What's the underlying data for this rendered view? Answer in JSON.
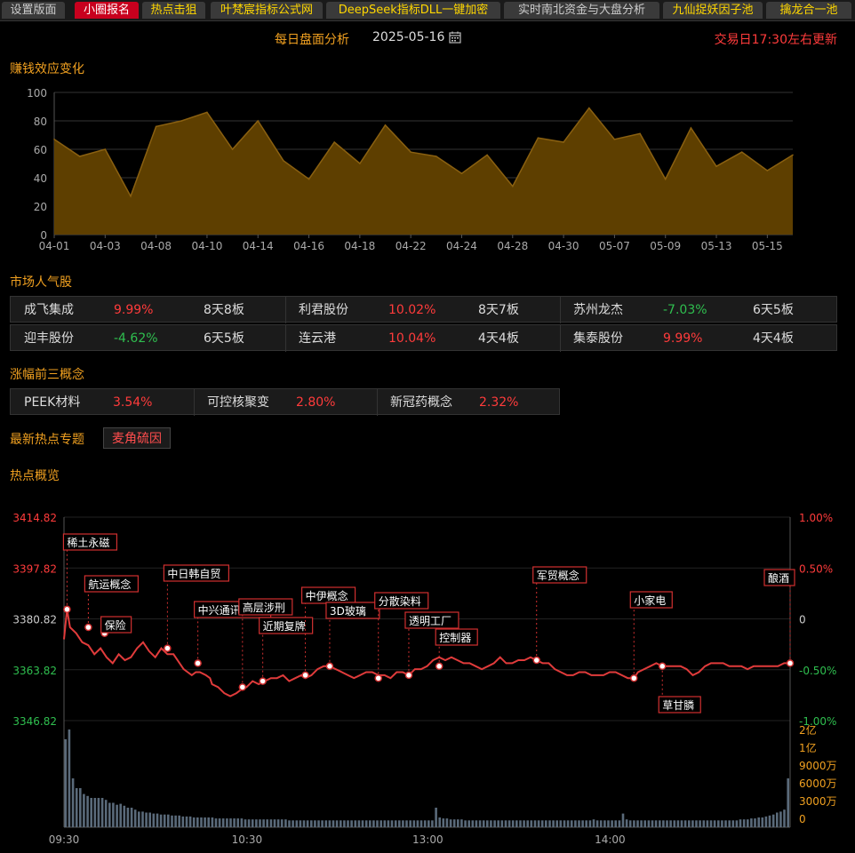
{
  "tabs": [
    {
      "label": "设置版面",
      "style": "normal"
    },
    {
      "label": "小圈报名",
      "style": "active"
    },
    {
      "label": "热点击狙",
      "style": "yellow"
    },
    {
      "label": "叶梵宸指标公式网",
      "style": "yellow"
    },
    {
      "label": "DeepSeek指标DLL一键加密",
      "style": "yellow"
    },
    {
      "label": "实时南北资金与大盘分析",
      "style": "normal"
    },
    {
      "label": "九仙捉妖因子池",
      "style": "yellow"
    },
    {
      "label": "擒龙合一池",
      "style": "yellow"
    }
  ],
  "header": {
    "title": "每日盘面分析",
    "date": "2025-05-16",
    "update_note": "交易日17:30左右更新"
  },
  "sections": {
    "money_effect": "赚钱效应变化",
    "popular": "市场人气股",
    "top3": "涨幅前三概念",
    "hot_topic": "最新热点专题",
    "overview": "热点概览"
  },
  "hot_topic_tag": "麦角硫因",
  "popular_stocks": [
    [
      {
        "name": "成飞集成",
        "pct": "9.99%",
        "dir": "up",
        "board": "8天8板"
      },
      {
        "name": "利君股份",
        "pct": "10.02%",
        "dir": "up",
        "board": "8天7板"
      },
      {
        "name": "苏州龙杰",
        "pct": "-7.03%",
        "dir": "down",
        "board": "6天5板"
      }
    ],
    [
      {
        "name": "迎丰股份",
        "pct": "-4.62%",
        "dir": "down",
        "board": "6天5板"
      },
      {
        "name": "连云港",
        "pct": "10.04%",
        "dir": "up",
        "board": "4天4板"
      },
      {
        "name": "集泰股份",
        "pct": "9.99%",
        "dir": "up",
        "board": "4天4板"
      }
    ]
  ],
  "top_concepts": [
    {
      "name": "PEEK材料",
      "pct": "3.54%"
    },
    {
      "name": "可控核聚变",
      "pct": "2.80%"
    },
    {
      "name": "新冠药概念",
      "pct": "2.32%"
    }
  ],
  "colors": {
    "up": "#ff3b3b",
    "down": "#2fbf4f",
    "accent": "#f0a020",
    "area_fill": "#5e3f00",
    "area_line": "#8a6010",
    "intraday": "#e03b3b",
    "volume": "#5a6a7a"
  },
  "chart_data": [
    {
      "type": "area",
      "title": "赚钱效应变化",
      "x": [
        "04-01",
        "04-02",
        "04-03",
        "04-07",
        "04-08",
        "04-09",
        "04-10",
        "04-11",
        "04-14",
        "04-15",
        "04-16",
        "04-17",
        "04-18",
        "04-21",
        "04-22",
        "04-23",
        "04-24",
        "04-25",
        "04-28",
        "04-29",
        "04-30",
        "05-06",
        "05-07",
        "05-08",
        "05-09",
        "05-12",
        "05-13",
        "05-14",
        "05-15",
        "05-16"
      ],
      "x_tick_labels": [
        "04-01",
        "04-03",
        "04-08",
        "04-10",
        "04-14",
        "04-16",
        "04-18",
        "04-22",
        "04-24",
        "04-28",
        "04-30",
        "05-07",
        "05-09",
        "05-13",
        "05-15"
      ],
      "values": [
        67,
        55,
        60,
        27,
        76,
        80,
        86,
        60,
        80,
        52,
        39,
        65,
        50,
        77,
        58,
        55,
        43,
        56,
        34,
        68,
        65,
        89,
        67,
        71,
        39,
        75,
        48,
        58,
        45,
        56
      ],
      "ylim": [
        0,
        100
      ],
      "y_ticks": [
        0,
        20,
        40,
        60,
        80,
        100
      ],
      "grid": true
    },
    {
      "type": "line",
      "title": "热点概览",
      "price_ticks": [
        "3414.82",
        "3397.82",
        "3380.82",
        "3363.82",
        "3346.82"
      ],
      "pct_ticks": [
        "1.00%",
        "0.50%",
        "0",
        "-0.50%",
        "-1.00%"
      ],
      "ylim": [
        3346.82,
        3414.82
      ],
      "x_time_labels": [
        "09:30",
        "10:30",
        "13:00",
        "14:00"
      ],
      "volume_ticks": [
        "2亿",
        "1亿",
        "9000万",
        "6000万",
        "3000万",
        "0"
      ],
      "points": [
        [
          0,
          3374
        ],
        [
          3,
          3384
        ],
        [
          6,
          3378
        ],
        [
          12,
          3376
        ],
        [
          18,
          3373
        ],
        [
          24,
          3372
        ],
        [
          30,
          3369
        ],
        [
          36,
          3371
        ],
        [
          42,
          3368
        ],
        [
          48,
          3366
        ],
        [
          54,
          3369
        ],
        [
          60,
          3367
        ],
        [
          66,
          3368
        ],
        [
          72,
          3371
        ],
        [
          78,
          3373
        ],
        [
          84,
          3370
        ],
        [
          90,
          3368
        ],
        [
          96,
          3371
        ],
        [
          102,
          3369
        ],
        [
          108,
          3369
        ],
        [
          114,
          3366
        ],
        [
          118,
          3364
        ],
        [
          122,
          3363
        ],
        [
          126,
          3362
        ],
        [
          130,
          3363
        ],
        [
          134,
          3363
        ],
        [
          140,
          3362
        ],
        [
          144,
          3361
        ],
        [
          146,
          3359
        ],
        [
          152,
          3358
        ],
        [
          158,
          3356
        ],
        [
          164,
          3355
        ],
        [
          170,
          3356
        ],
        [
          174,
          3357
        ],
        [
          180,
          3358
        ],
        [
          186,
          3360
        ],
        [
          192,
          3359
        ],
        [
          198,
          3360
        ],
        [
          204,
          3361
        ],
        [
          210,
          3361
        ],
        [
          216,
          3362
        ],
        [
          222,
          3360
        ],
        [
          228,
          3361
        ],
        [
          234,
          3362
        ],
        [
          238,
          3361
        ],
        [
          244,
          3362
        ],
        [
          250,
          3364
        ],
        [
          256,
          3365
        ],
        [
          262,
          3365
        ],
        [
          268,
          3364
        ],
        [
          274,
          3363
        ],
        [
          280,
          3362
        ],
        [
          286,
          3361
        ],
        [
          292,
          3362
        ],
        [
          298,
          3363
        ],
        [
          304,
          3363
        ],
        [
          310,
          3362
        ],
        [
          316,
          3362
        ],
        [
          322,
          3361
        ],
        [
          328,
          3363
        ],
        [
          334,
          3363
        ],
        [
          340,
          3362
        ],
        [
          346,
          3364
        ],
        [
          352,
          3364
        ],
        [
          358,
          3365
        ],
        [
          364,
          3367
        ],
        [
          370,
          3368
        ],
        [
          376,
          3367
        ],
        [
          382,
          3368
        ],
        [
          388,
          3367
        ],
        [
          394,
          3366
        ],
        [
          400,
          3366
        ],
        [
          406,
          3365
        ],
        [
          412,
          3364
        ],
        [
          418,
          3365
        ],
        [
          424,
          3366
        ],
        [
          430,
          3368
        ],
        [
          436,
          3366
        ],
        [
          442,
          3366
        ],
        [
          448,
          3367
        ],
        [
          454,
          3367
        ],
        [
          460,
          3368
        ],
        [
          466,
          3367
        ],
        [
          472,
          3366
        ],
        [
          478,
          3366
        ],
        [
          484,
          3364
        ],
        [
          490,
          3363
        ],
        [
          496,
          3362
        ],
        [
          502,
          3362
        ],
        [
          508,
          3363
        ],
        [
          514,
          3363
        ],
        [
          520,
          3362
        ],
        [
          526,
          3362
        ],
        [
          532,
          3362
        ],
        [
          538,
          3363
        ],
        [
          544,
          3363
        ],
        [
          550,
          3362
        ],
        [
          556,
          3361
        ],
        [
          562,
          3361
        ],
        [
          566,
          3363
        ],
        [
          572,
          3364
        ],
        [
          578,
          3365
        ],
        [
          584,
          3366
        ],
        [
          590,
          3365
        ],
        [
          596,
          3365
        ],
        [
          602,
          3365
        ],
        [
          608,
          3365
        ],
        [
          614,
          3364
        ],
        [
          620,
          3362
        ],
        [
          626,
          3363
        ],
        [
          632,
          3365
        ],
        [
          638,
          3366
        ],
        [
          644,
          3366
        ],
        [
          650,
          3366
        ],
        [
          656,
          3365
        ],
        [
          662,
          3365
        ],
        [
          668,
          3365
        ],
        [
          674,
          3364
        ],
        [
          680,
          3365
        ],
        [
          686,
          3365
        ],
        [
          692,
          3365
        ],
        [
          698,
          3365
        ],
        [
          704,
          3365
        ],
        [
          710,
          3366
        ],
        [
          716,
          3366
        ]
      ],
      "events": [
        {
          "label": "稀土永磁",
          "t": 3,
          "value": 3384
        },
        {
          "label": "航运概念",
          "t": 24,
          "value": 3378
        },
        {
          "label": "保险",
          "t": 40,
          "value": 3376
        },
        {
          "label": "中日韩自贸",
          "t": 102,
          "value": 3371
        },
        {
          "label": "中兴通讯概念",
          "t": 132,
          "value": 3366
        },
        {
          "label": "高层涉刑",
          "t": 176,
          "value": 3358
        },
        {
          "label": "近期复牌",
          "t": 196,
          "value": 3360
        },
        {
          "label": "中伊概念",
          "t": 238,
          "value": 3362
        },
        {
          "label": "3D玻璃",
          "t": 262,
          "value": 3365
        },
        {
          "label": "分散染料",
          "t": 310,
          "value": 3361
        },
        {
          "label": "透明工厂",
          "t": 340,
          "value": 3362
        },
        {
          "label": "控制器",
          "t": 370,
          "value": 3365
        },
        {
          "label": "军贸概念",
          "t": 466,
          "value": 3367
        },
        {
          "label": "小家电",
          "t": 562,
          "value": 3361
        },
        {
          "label": "草甘膦",
          "t": 590,
          "value": 3365
        },
        {
          "label": "酿酒",
          "t": 716,
          "value": 3366
        }
      ],
      "volume": [
        9,
        10,
        5,
        4,
        4,
        3.4,
        3.2,
        3.0,
        3.0,
        3.0,
        3.0,
        2.8,
        2.5,
        2.5,
        2.3,
        2.4,
        2.2,
        2.0,
        2.0,
        1.8,
        1.6,
        1.6,
        1.5,
        1.5,
        1.4,
        1.4,
        1.3,
        1.3,
        1.3,
        1.2,
        1.2,
        1.2,
        1.1,
        1.1,
        1.1,
        1.0,
        1.0,
        1.0,
        1.0,
        1.0,
        1.0,
        0.9,
        0.9,
        0.9,
        0.9,
        0.9,
        0.9,
        0.9,
        0.9,
        0.8,
        0.8,
        0.8,
        0.8,
        0.8,
        0.8,
        0.8,
        0.8,
        0.8,
        0.8,
        0.8,
        0.8,
        0.7,
        0.7,
        0.7,
        0.7,
        0.7,
        0.7,
        0.7,
        0.7,
        0.7,
        0.7,
        0.7,
        0.7,
        0.7,
        0.7,
        0.7,
        0.7,
        0.7,
        0.7,
        0.7,
        0.7,
        0.7,
        0.7,
        0.7,
        0.7,
        0.7,
        0.7,
        0.7,
        0.7,
        0.7,
        0.7,
        0.7,
        0.7,
        0.7,
        0.7,
        0.7,
        0.7,
        0.7,
        0.7,
        0.7,
        0.7,
        2.0,
        1.0,
        0.9,
        0.9,
        0.8,
        0.8,
        0.8,
        0.8,
        0.7,
        0.7,
        0.7,
        0.7,
        0.7,
        0.7,
        0.7,
        0.7,
        0.7,
        0.7,
        0.7,
        0.7,
        0.7,
        0.7,
        0.7,
        0.7,
        0.7,
        0.7,
        0.7,
        0.7,
        0.7,
        0.7,
        0.7,
        0.7,
        0.7,
        0.7,
        0.7,
        0.7,
        0.7,
        0.7,
        0.7,
        0.7,
        0.7,
        0.7,
        0.7,
        0.8,
        0.7,
        0.7,
        0.7,
        0.7,
        0.7,
        0.7,
        0.7,
        1.4,
        0.8,
        0.7,
        0.7,
        0.7,
        0.7,
        0.7,
        0.7,
        0.7,
        0.7,
        0.7,
        0.7,
        0.7,
        0.7,
        0.7,
        0.7,
        0.7,
        0.7,
        0.7,
        0.7,
        0.7,
        0.7,
        0.7,
        0.7,
        0.7,
        0.7,
        0.7,
        0.7,
        0.7,
        0.7,
        0.7,
        0.7,
        0.8,
        0.8,
        0.8,
        0.9,
        0.9,
        1.0,
        1.0,
        1.1,
        1.2,
        1.3,
        1.5,
        1.6,
        1.8,
        5.0
      ]
    }
  ]
}
